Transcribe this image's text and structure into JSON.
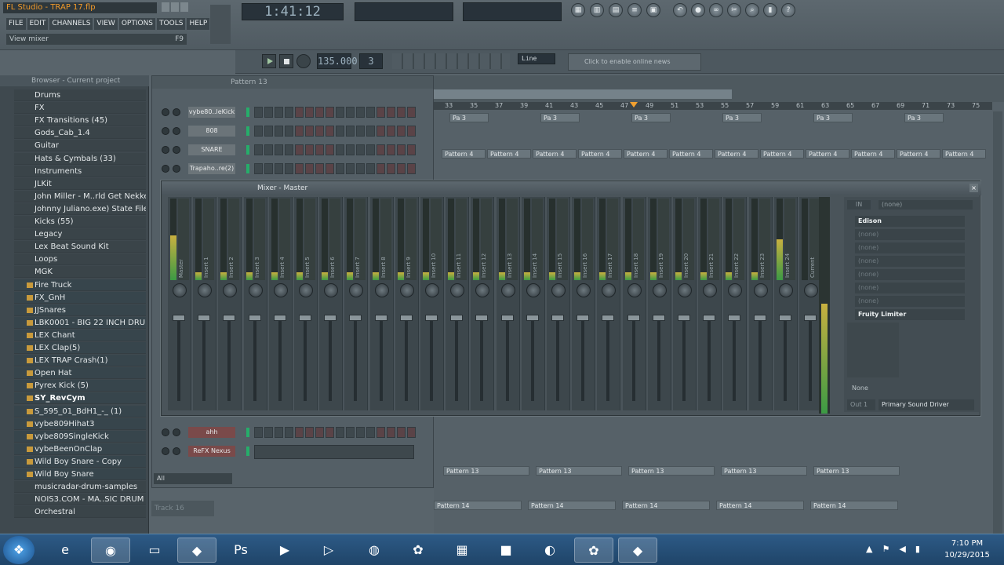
{
  "app": {
    "title": "FL Studio",
    "project": "TRAP 17.flp",
    "hint": "View mixer",
    "hint_key": "F9"
  },
  "menu": [
    "FILE",
    "EDIT",
    "CHANNELS",
    "VIEW",
    "OPTIONS",
    "TOOLS",
    "HELP"
  ],
  "transport": {
    "time": "1:41:12",
    "tempo": "135.000",
    "pattern_num": "3",
    "snap": "Line",
    "hint_bar": "Click to enable online news"
  },
  "browser": {
    "title": "Browser - Current project",
    "items": [
      {
        "label": "Drums",
        "type": "folder"
      },
      {
        "label": "FX",
        "type": "folder"
      },
      {
        "label": "FX Transitions (45)",
        "type": "folder"
      },
      {
        "label": "Gods_Cab_1.4",
        "type": "folder"
      },
      {
        "label": "Guitar",
        "type": "folder"
      },
      {
        "label": "Hats & Cymbals (33)",
        "type": "folder"
      },
      {
        "label": "Instruments",
        "type": "folder"
      },
      {
        "label": "JLKit",
        "type": "folder"
      },
      {
        "label": "John Miller - M..rld Get Nekked",
        "type": "folder"
      },
      {
        "label": "Johnny Juliano.exe) State Files",
        "type": "folder"
      },
      {
        "label": "Kicks (55)",
        "type": "folder"
      },
      {
        "label": "Legacy",
        "type": "folder"
      },
      {
        "label": "Lex Beat Sound Kit",
        "type": "folder"
      },
      {
        "label": "Loops",
        "type": "folder"
      },
      {
        "label": "MGK",
        "type": "folder"
      },
      {
        "label": "Fire Truck",
        "type": "file"
      },
      {
        "label": "FX_GnH",
        "type": "file"
      },
      {
        "label": "JJSnares",
        "type": "file"
      },
      {
        "label": "LBK0001 - BIG 22 INCH DRUM",
        "type": "file"
      },
      {
        "label": "LEX Chant",
        "type": "file"
      },
      {
        "label": "LEX Clap(5)",
        "type": "file"
      },
      {
        "label": "LEX TRAP Crash(1)",
        "type": "file"
      },
      {
        "label": "Open Hat",
        "type": "file"
      },
      {
        "label": "Pyrex Kick (5)",
        "type": "file"
      },
      {
        "label": "SY_RevCym",
        "type": "file",
        "selected": true
      },
      {
        "label": "S_595_01_BdH1_-_ (1)",
        "type": "file"
      },
      {
        "label": "vybe809Hihat3",
        "type": "file"
      },
      {
        "label": "vybe809SingleKick",
        "type": "file"
      },
      {
        "label": "vybeBeenOnClap",
        "type": "file"
      },
      {
        "label": "Wild Boy Snare - Copy",
        "type": "file"
      },
      {
        "label": "Wild Boy Snare",
        "type": "file"
      },
      {
        "label": "musicradar-drum-samples",
        "type": "folder"
      },
      {
        "label": "NOIS3.COM - MA..SIC DRUM KIT",
        "type": "folder"
      },
      {
        "label": "Orchestral",
        "type": "folder"
      }
    ]
  },
  "rack": {
    "title": "Pattern 13",
    "filter": "All",
    "channels": [
      {
        "name": "vybe80..leKick"
      },
      {
        "name": "808"
      },
      {
        "name": "SNARE"
      },
      {
        "name": "Trapaho..re(2)"
      },
      {
        "name": "ahh",
        "red": true
      },
      {
        "name": "ReFX Nexus #2",
        "red": true
      }
    ]
  },
  "playlist": {
    "timeline": [
      "33",
      "35",
      "37",
      "39",
      "41",
      "43",
      "45",
      "47",
      "49",
      "51",
      "53",
      "55",
      "57",
      "59",
      "61",
      "63",
      "65",
      "67",
      "69",
      "71",
      "73",
      "75"
    ],
    "row1": [
      "Pa 3",
      "Pa 3",
      "Pa 3",
      "Pa 3",
      "Pa 3",
      "Pa 3"
    ],
    "row2": [
      "Pattern 4",
      "Pattern 4",
      "Pattern 4",
      "Pattern 4",
      "Pattern 4",
      "Pattern 4",
      "Pattern 4",
      "Pattern 4",
      "Pattern 4",
      "Pattern 4",
      "Pattern 4",
      "Pattern 4"
    ],
    "row3": [
      "Pattern 13",
      "Pattern 13",
      "Pattern 13",
      "Pattern 13",
      "Pattern 13"
    ],
    "row4": [
      "Pattern 14",
      "Pattern 14",
      "Pattern 14",
      "Pattern 14",
      "Pattern 14"
    ],
    "track_label": "Track 16"
  },
  "mixer": {
    "title": "Mixer - Master",
    "strips": [
      "Master",
      "Insert 1",
      "Insert 2",
      "Insert 3",
      "Insert 4",
      "Insert 5",
      "Insert 6",
      "Insert 7",
      "Insert 8",
      "Insert 9",
      "Insert 10",
      "Insert 11",
      "Insert 12",
      "Insert 13",
      "Insert 14",
      "Insert 15",
      "Insert 16",
      "Insert 17",
      "Insert 18",
      "Insert 19",
      "Insert 20",
      "Insert 21",
      "Insert 22",
      "Insert 23",
      "Insert 24",
      "Current"
    ],
    "levels": [
      0.55,
      0.1,
      0.1,
      0.1,
      0.1,
      0.1,
      0.1,
      0.1,
      0.1,
      0.1,
      0.1,
      0.1,
      0.1,
      0.1,
      0.1,
      0.1,
      0.1,
      0.1,
      0.1,
      0.1,
      0.1,
      0.1,
      0.1,
      0.1,
      0.5,
      0.0
    ],
    "fx_slots": [
      "Edison",
      "(none)",
      "(none)",
      "(none)",
      "(none)",
      "(none)",
      "(none)",
      "Fruity Limiter"
    ],
    "output": "Primary Sound Driver",
    "output_label": "Out 1",
    "none_label": "(none)",
    "in_label": "IN",
    "none_btn": "None"
  },
  "taskbar": {
    "time": "7:10 PM",
    "date": "10/29/2015"
  }
}
